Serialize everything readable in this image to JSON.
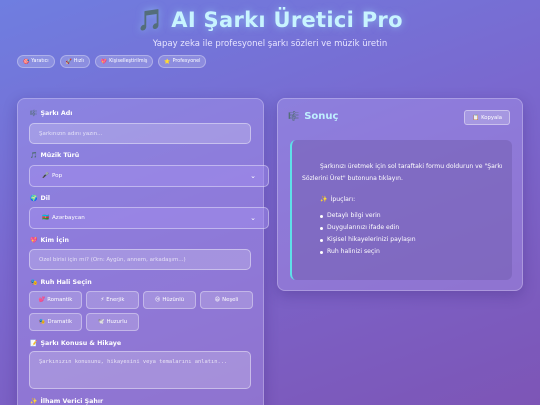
{
  "header": {
    "title": "AI Şarkı Üretici Pro",
    "title_icon": "🎵",
    "subtitle": "Yapay zeka ile profesyonel şarkı sözleri ve müzik üretin"
  },
  "badges": [
    {
      "icon": "🎯",
      "label": "Yaratıcı"
    },
    {
      "icon": "🚀",
      "label": "Hızlı"
    },
    {
      "icon": "💖",
      "label": "Kişiselleştirilmiş"
    },
    {
      "icon": "⭐",
      "label": "Profesyonel"
    }
  ],
  "form": {
    "song_name": {
      "icon": "🎼",
      "label": "Şarkı Adı",
      "placeholder": "Şarkınızın adını yazın..."
    },
    "genre": {
      "icon": "🎵",
      "label": "Müzik Türü",
      "value_icon": "🎤",
      "value": "Pop"
    },
    "language": {
      "icon": "🌍",
      "label": "Dil",
      "value_icon": "🇦🇿",
      "value": "Azərbaycan"
    },
    "for_whom": {
      "icon": "💖",
      "label": "Kim İçin",
      "placeholder": "Özel birisi için mi? (Örn: Aygün, annem, arkadaşım...)"
    },
    "mood": {
      "icon": "🎭",
      "label": "Ruh Hali Seçin",
      "options": [
        {
          "icon": "💕",
          "label": "Romantik"
        },
        {
          "icon": "⚡",
          "label": "Enerjik"
        },
        {
          "icon": "😢",
          "label": "Hüzünlü"
        },
        {
          "icon": "😄",
          "label": "Neşeli"
        },
        {
          "icon": "🎭",
          "label": "Dramatik"
        },
        {
          "icon": "🕊️",
          "label": "Huzurlu"
        }
      ]
    },
    "topic": {
      "icon": "📝",
      "label": "Şarkı Konusu & Hikaye",
      "placeholder": "Şarkınızın konusunu, hikayesini veya temalarını anlatın..."
    },
    "inspiration": {
      "icon": "✨",
      "label": "İlham Verici Şahır"
    }
  },
  "result": {
    "icon": "🎼",
    "title": "Sonuç",
    "copy_icon": "📋",
    "copy_label": "Kopyala",
    "intro": "Şarkınızı üretmek için sol taraftaki formu doldurun ve \"Şarkı Sözlerini Üret\" butonuna tıklayın.",
    "tips_icon": "✨",
    "tips_title": "İpuçları:",
    "tips": [
      "Detaylı bilgi verin",
      "Duygularınızı ifade edin",
      "Kişisel hikayelerinizi paylaşın",
      "Ruh halinizi seçin"
    ]
  }
}
